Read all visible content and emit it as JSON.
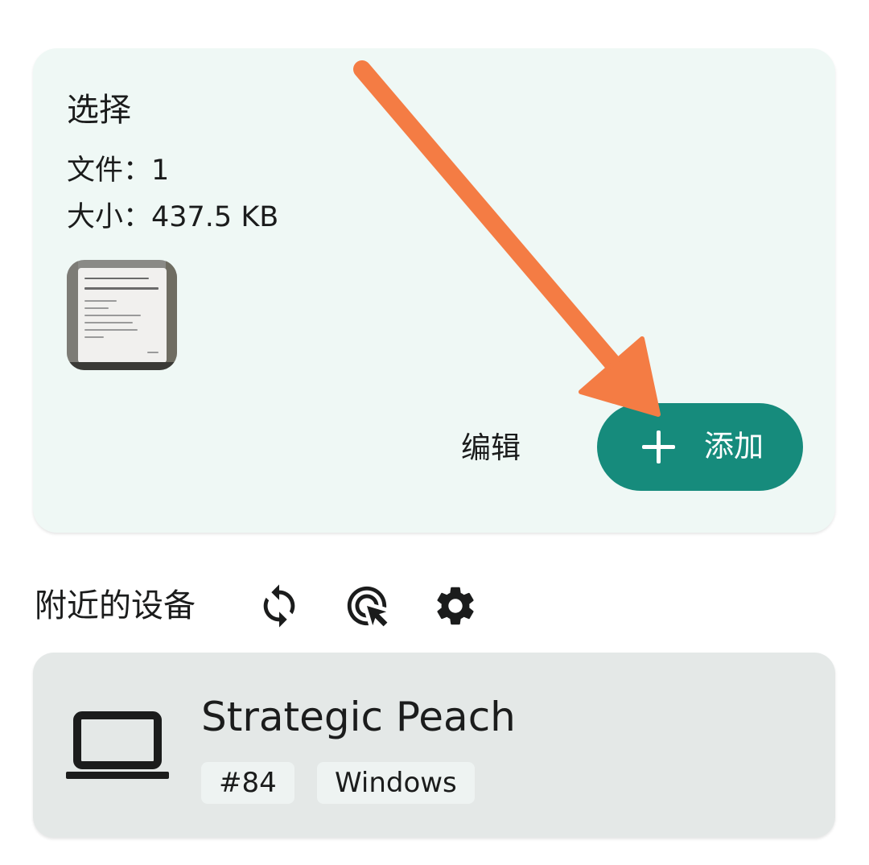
{
  "selection": {
    "title": "选择",
    "files_line": "文件：1",
    "size_line": "大小：437.5 KB",
    "edit_label": "编辑",
    "add_label": "添加"
  },
  "nearby": {
    "title": "附近的设备",
    "icons": [
      "refresh-icon",
      "select-target-icon",
      "gear-icon"
    ]
  },
  "device": {
    "name": "Strategic Peach",
    "id_tag": "#84",
    "os_tag": "Windows",
    "icon": "laptop-icon"
  },
  "colors": {
    "card_bg": "#eff8f5",
    "accent": "#168b7c",
    "arrow": "#f47c44",
    "device_card_bg": "#e4e8e7",
    "chip_bg": "#eef3f2"
  }
}
